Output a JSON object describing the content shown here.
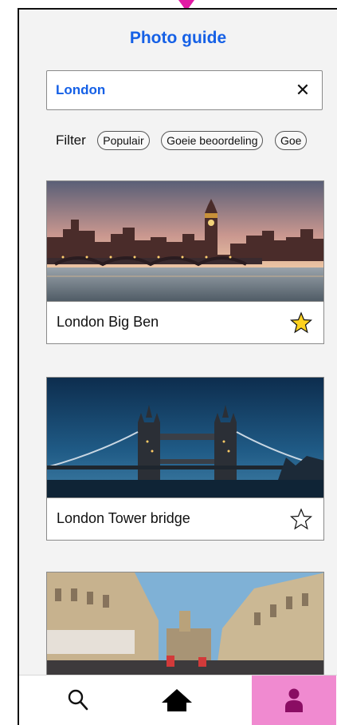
{
  "header": {
    "title": "Photo guide"
  },
  "search": {
    "value": "London",
    "clear_label": "✕"
  },
  "filter": {
    "label": "Filter",
    "chips": [
      "Populair",
      "Goeie beoordeling",
      "Goe"
    ]
  },
  "cards": [
    {
      "title": "London Big Ben",
      "favorited": true
    },
    {
      "title": "London Tower bridge",
      "favorited": false
    },
    {
      "title": "",
      "favorited": false
    }
  ],
  "nav": {
    "items": [
      "search-icon",
      "home-icon",
      "user-icon"
    ],
    "active": "user-icon"
  },
  "colors": {
    "accent": "#1560e6",
    "active_tab": "#f08ad0",
    "pointer": "#e21aa4",
    "star_fill": "#ffd21f"
  }
}
